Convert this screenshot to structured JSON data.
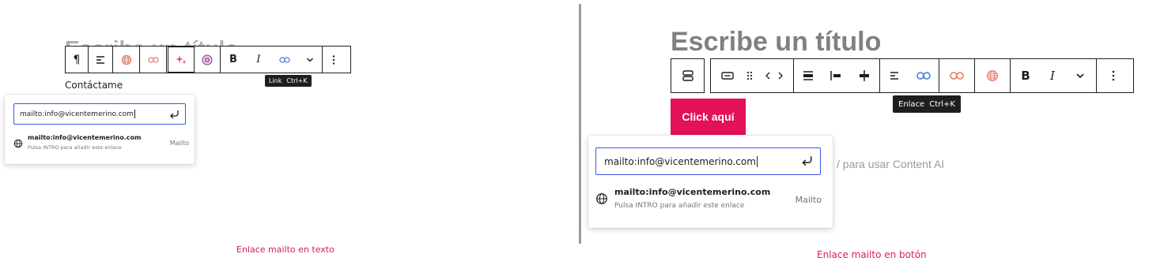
{
  "left": {
    "title": "Escribe un título",
    "paragraph": "Contáctame",
    "toolbar_icons": [
      "pilcrow-icon",
      "align-left-icon",
      "globe-icon",
      "link-icon",
      "sparkle-icon",
      "at-sign-icon",
      "bold-icon",
      "italic-icon",
      "link-icon",
      "chevron-down-icon",
      "more-options-icon"
    ],
    "bold_label": "B",
    "italic_label": "I",
    "pilcrow_label": "¶",
    "tooltip_label": "Link",
    "tooltip_shortcut": "Ctrl+K",
    "link_input_value": "mailto:info@vicentemerino.com",
    "suggestion_title": "mailto:info@vicentemerino.com",
    "suggestion_hint": "Pulsa INTRO para añadir este enlace",
    "suggestion_type": "Mailto",
    "caption": "Enlace mailto en texto"
  },
  "right": {
    "title": "Escribe un título",
    "toolbar_icons": [
      "button-block-icon",
      "button-icon",
      "drag-handle-icon",
      "move-arrows-icon",
      "align-center-icon",
      "align-left-bar-icon",
      "align-vertical-center-icon",
      "align-left-icon",
      "link-icon",
      "unlink-icon",
      "globe-icon",
      "bold-icon",
      "italic-icon",
      "chevron-down-icon",
      "more-options-icon"
    ],
    "bold_label": "B",
    "italic_label": "I",
    "button_label": "Click aquí",
    "tooltip_label": "Enlace",
    "tooltip_shortcut": "Ctrl+K",
    "background_hint": "/ para usar Content AI",
    "link_input_value": "mailto:info@vicentemerino.com",
    "suggestion_title": "mailto:info@vicentemerino.com",
    "suggestion_hint": "Pulsa INTRO para añadir este enlace",
    "suggestion_type": "Mailto",
    "caption": "Enlace mailto en botón"
  },
  "colors": {
    "accent_pink": "#d81b60",
    "button_bg": "#e3105a",
    "link_blue": "#3858e9",
    "orange_icon": "#e07a5f",
    "tooltip_bg": "#1e1e1e"
  }
}
